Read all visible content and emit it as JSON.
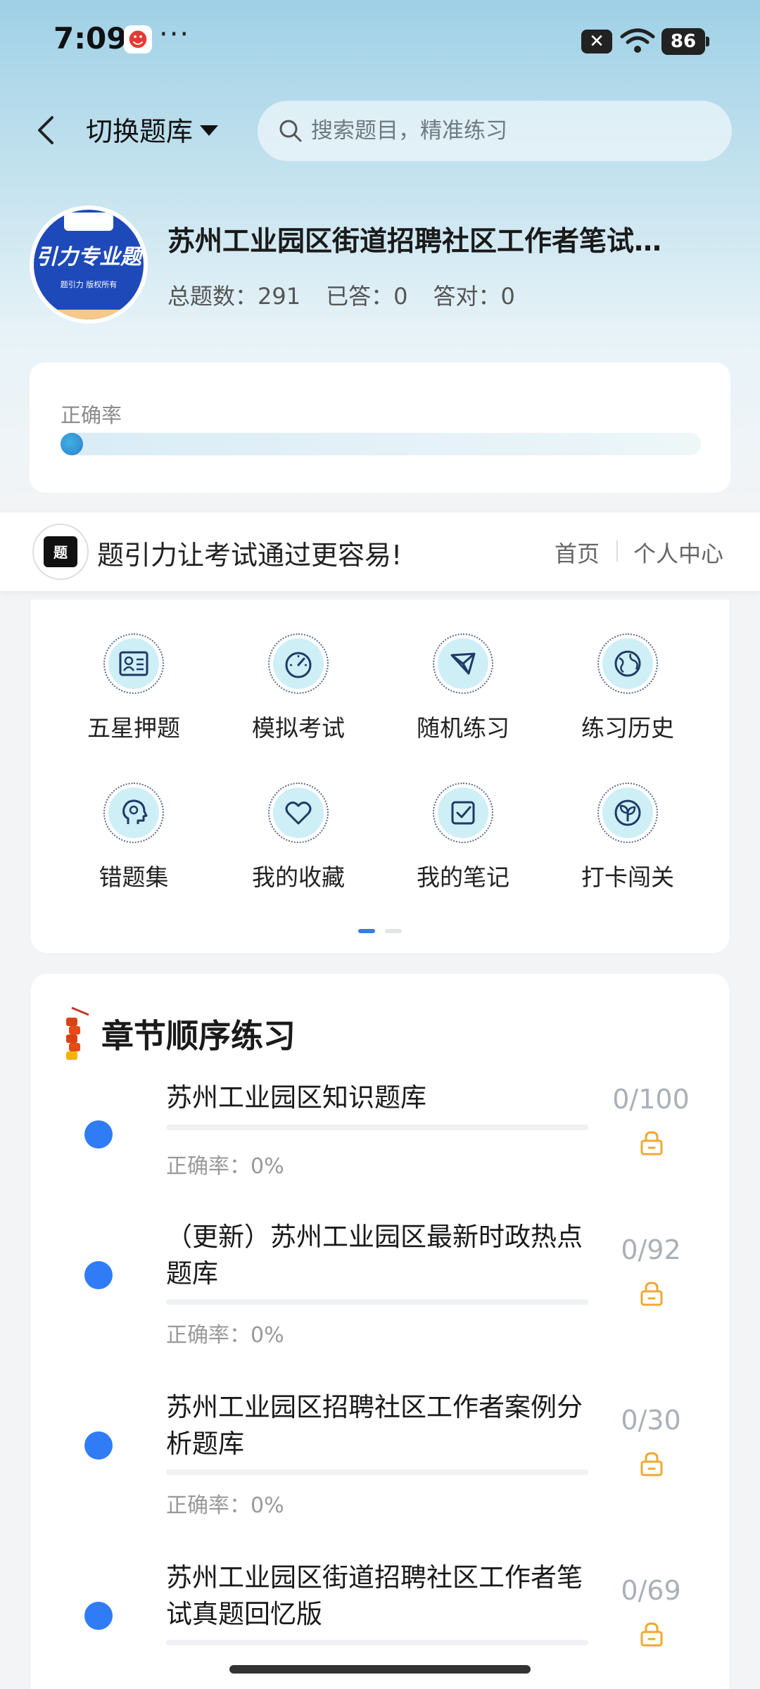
{
  "status_bar": {
    "time": "7:09",
    "more": "···",
    "battery": "86"
  },
  "header": {
    "switch_label": "切换题库",
    "search_placeholder": "搜索题目，精准练习"
  },
  "bank": {
    "title": "苏州工业园区街道招聘社区工作者笔试…",
    "total_label": "总题数：291",
    "answered_label": "已答：0",
    "correct_label": "答对：0",
    "logo_text": "引力专业题",
    "logo_sub": "题引力 版权所有"
  },
  "accuracy": {
    "label": "正确率",
    "value": 0
  },
  "banner": {
    "logo_text": "题引力",
    "slogan": "题引力让考试通过更容易!",
    "home": "首页",
    "user_center": "个人中心"
  },
  "features": [
    {
      "label": "五星押题",
      "icon": "id-card-icon"
    },
    {
      "label": "模拟考试",
      "icon": "speedometer-icon"
    },
    {
      "label": "随机练习",
      "icon": "shuffle-icon"
    },
    {
      "label": "练习历史",
      "icon": "globe-icon"
    },
    {
      "label": "错题集",
      "icon": "head-icon"
    },
    {
      "label": "我的收藏",
      "icon": "heart-icon"
    },
    {
      "label": "我的笔记",
      "icon": "note-check-icon"
    },
    {
      "label": "打卡闯关",
      "icon": "sprout-icon"
    }
  ],
  "chapters": {
    "title": "章节顺序练习",
    "items": [
      {
        "title": "苏州工业园区知识题库",
        "count": "0/100",
        "accuracy": "正确率：0%"
      },
      {
        "title": "（更新）苏州工业园区最新时政热点题库",
        "count": "0/92",
        "accuracy": "正确率：0%"
      },
      {
        "title": "苏州工业园区招聘社区工作者案例分析题库",
        "count": "0/30",
        "accuracy": "正确率：0%"
      },
      {
        "title": "苏州工业园区街道招聘社区工作者笔试真题回忆版",
        "count": "0/69",
        "accuracy": ""
      }
    ]
  },
  "colors": {
    "accent": "#2f7cf6",
    "lock": "#f0a830"
  }
}
